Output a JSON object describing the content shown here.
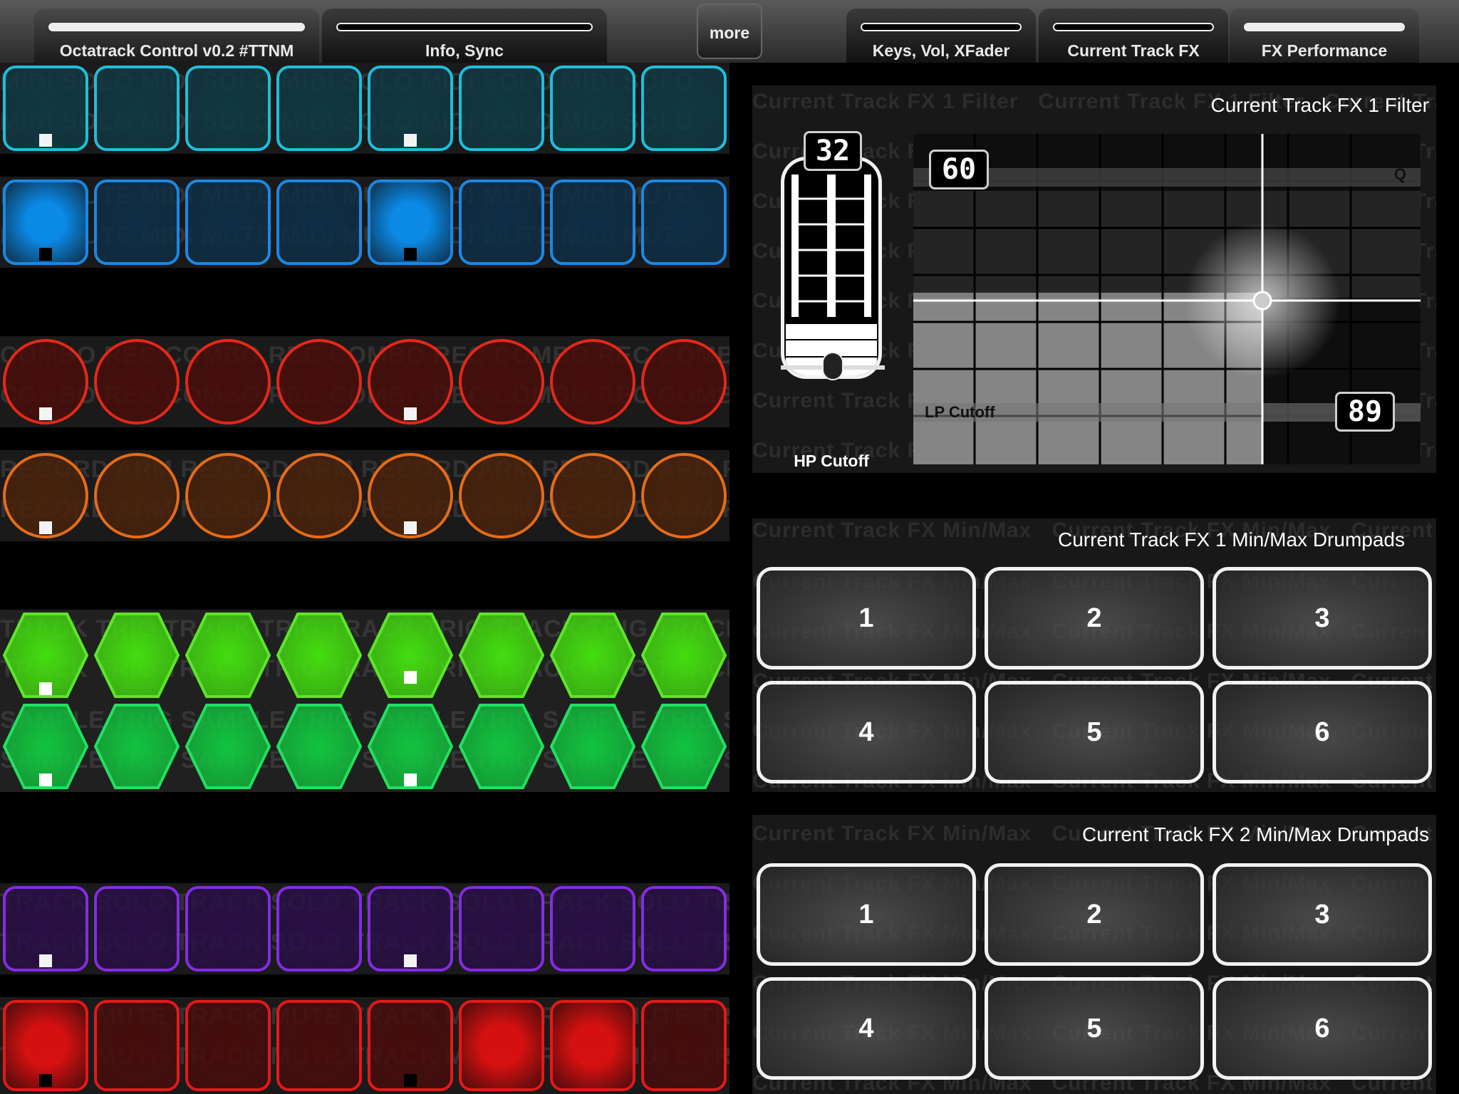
{
  "tabs": [
    {
      "label": "Octatrack Control v0.2 #TTNM",
      "active": true
    },
    {
      "label": "Info, Sync",
      "active": false
    },
    {
      "label": "Keys, Vol, XFader",
      "active": false
    },
    {
      "label": "Current Track FX",
      "active": false
    },
    {
      "label": "FX Performance",
      "active": true
    }
  ],
  "more_label": "more",
  "pad_rows": [
    {
      "name": "midi-solo",
      "watermark": "MIDI SOLO",
      "shape": "square",
      "color": "#1fc6e6",
      "fill": "#103a44",
      "active": [],
      "marked": [
        0,
        4
      ],
      "mark_color": "#ffffff"
    },
    {
      "name": "midi-mute",
      "watermark": "MIDI MUTE",
      "shape": "square",
      "color": "#1a8ef0",
      "fill": "#0e2f48",
      "active": [
        0,
        4
      ],
      "active_fill": "#0a8ff0",
      "marked": [
        0,
        4
      ],
      "mark_color": "#000000"
    },
    {
      "name": "combo-rec",
      "watermark": "COMBO REC",
      "shape": "circle",
      "color": "#f02818",
      "fill": "#4a0e0a",
      "active": [],
      "marked": [
        0,
        4
      ],
      "mark_color": "#ffffff"
    },
    {
      "name": "record-arm",
      "watermark": "RECORD ARM",
      "shape": "circle",
      "color": "#f07018",
      "fill": "#4a230c",
      "active": [],
      "marked": [
        0,
        4
      ],
      "mark_color": "#ffffff"
    },
    {
      "name": "track-trig",
      "watermark": "TRACK TRIG",
      "shape": "hex",
      "color": "#5ce62a",
      "fill": "#44dd10",
      "active": [],
      "marked": [
        0,
        4
      ],
      "mark_color": "#ffffff"
    },
    {
      "name": "sample-trig",
      "watermark": "SAMPLE TRIG",
      "shape": "hex",
      "color": "#22e060",
      "fill": "#12c43e",
      "active": [],
      "marked": [
        0,
        4
      ],
      "mark_color": "#ffffff"
    },
    {
      "name": "track-solo",
      "watermark": "TRACK SOLO",
      "shape": "square",
      "color": "#8a2cf0",
      "fill": "#2a0f48",
      "active": [],
      "marked": [
        0,
        4
      ],
      "mark_color": "#ffffff"
    },
    {
      "name": "track-mute",
      "watermark": "TRACK MUTE",
      "shape": "square",
      "color": "#f01818",
      "fill": "#4a0c0c",
      "active": [
        0,
        5,
        6
      ],
      "active_fill": "#e01010",
      "marked": [
        0,
        4
      ],
      "mark_color": "#000000"
    }
  ],
  "filter": {
    "title": "Current Track FX 1 Filter",
    "watermark": "Current Track FX 1 Filter",
    "hp_value": "32",
    "hp_label": "HP Cutoff",
    "hp_level": 0.22,
    "q_value": "60",
    "q_label": "Q",
    "lp_value": "89",
    "lp_label": "LP Cutoff"
  },
  "drumpads1": {
    "title": "Current Track FX 1 Min/Max Drumpads",
    "watermark": "Current Track FX Min/Max",
    "pads": [
      "1",
      "2",
      "3",
      "4",
      "5",
      "6"
    ]
  },
  "drumpads2": {
    "title": "Current Track FX 2 Min/Max Drumpads",
    "watermark": "Current Track FX Min/Max",
    "pads": [
      "1",
      "2",
      "3",
      "4",
      "5",
      "6"
    ]
  }
}
